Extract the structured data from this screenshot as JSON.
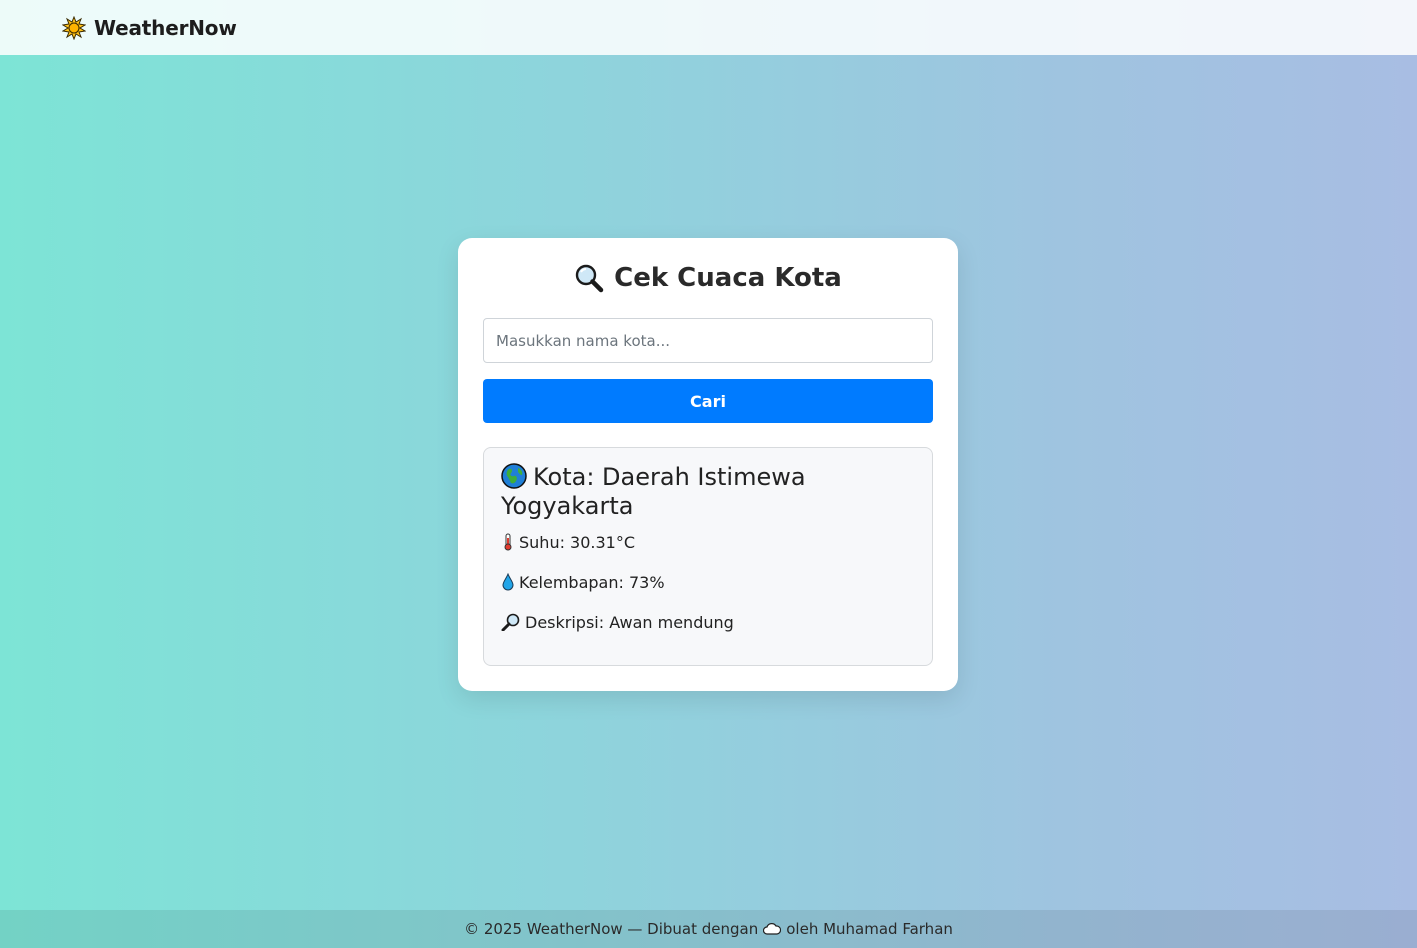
{
  "navbar": {
    "brand_icon": "sun-behind-cloud-icon",
    "brand_name": "WeatherNow"
  },
  "card": {
    "title_icon": "magnifying-glass-icon",
    "title": "Cek Cuaca Kota",
    "input": {
      "placeholder": "Masukkan nama kota...",
      "value": ""
    },
    "search_button": "Cari",
    "result": {
      "city_icon": "globe-icon",
      "city": "Kota: Daerah Istimewa Yogyakarta",
      "temperature": {
        "icon": "thermometer-icon",
        "text": "Suhu: 30.31°C"
      },
      "humidity": {
        "icon": "droplet-icon",
        "text": "Kelembapan: 73%"
      },
      "description": {
        "icon": "magnifying-glass-icon",
        "text": "Deskripsi: Awan mendung"
      }
    }
  },
  "footer": {
    "before": "© 2025 WeatherNow — Dibuat dengan",
    "icon": "cloud-icon",
    "after": "oleh Muhamad Farhan"
  },
  "colors": {
    "accent": "#007bff",
    "gradient_start": "#7de4d6",
    "gradient_end": "#a8bde3"
  }
}
